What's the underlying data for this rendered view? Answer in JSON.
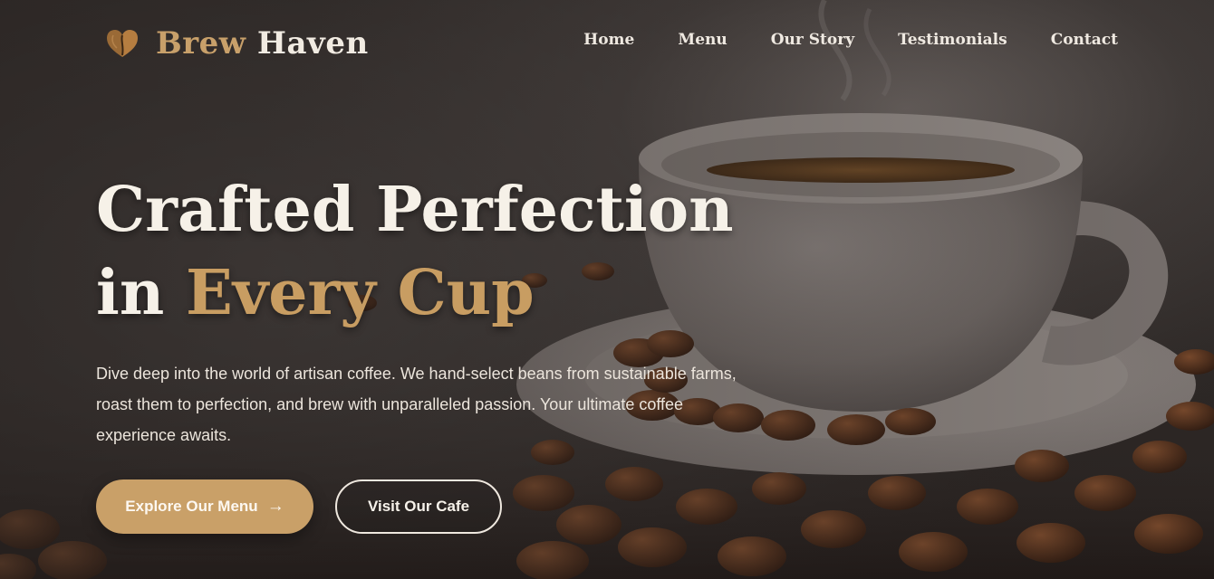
{
  "brand": {
    "name_part1": "Brew",
    "name_part2": "Haven",
    "logo_icon": "coffee-bean-heart-icon",
    "accent_color": "#c9a068"
  },
  "nav": {
    "items": [
      {
        "label": "Home"
      },
      {
        "label": "Menu"
      },
      {
        "label": "Our Story"
      },
      {
        "label": "Testimonials"
      },
      {
        "label": "Contact"
      }
    ]
  },
  "hero": {
    "headline_line1": "Crafted Perfection",
    "headline_line2_prefix": "in ",
    "headline_line2_accent": "Every Cup",
    "description": "Dive deep into the world of artisan coffee. We hand-select beans from sustainable farms, roast them to perfection, and brew with unparalleled passion. Your ultimate coffee experience awaits.",
    "primary_button": "Explore Our Menu",
    "primary_button_icon": "arrow-right-icon",
    "secondary_button": "Visit Our Cafe"
  }
}
